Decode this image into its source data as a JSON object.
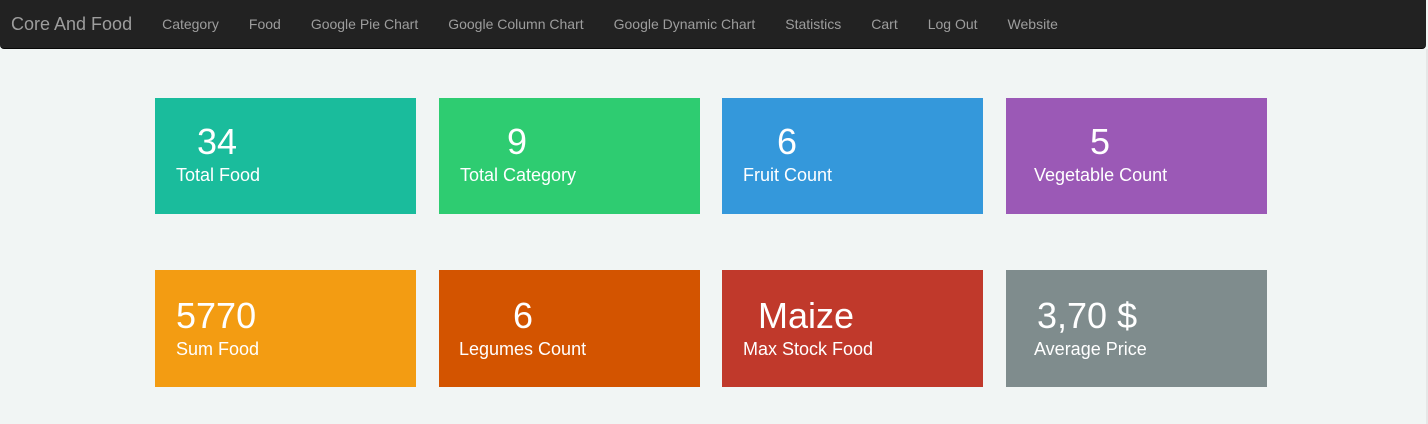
{
  "navbar": {
    "brand": "Core And Food",
    "links": [
      "Category",
      "Food",
      "Google Pie Chart",
      "Google Column Chart",
      "Google Dynamic Chart",
      "Statistics",
      "Cart",
      "Log Out",
      "Website"
    ]
  },
  "colors": {
    "navbar_bg": "#222222",
    "nav_text": "#9d9d9d",
    "page_bg": "#f1f5f4"
  },
  "tiles": [
    {
      "value": "34",
      "label": "Total Food",
      "color": "#1abc9c"
    },
    {
      "value": "9",
      "label": "Total Category",
      "color": "#2ecc71"
    },
    {
      "value": "6",
      "label": "Fruit Count",
      "color": "#3498db"
    },
    {
      "value": "5",
      "label": "Vegetable Count",
      "color": "#9b59b6"
    },
    {
      "value": "5770",
      "label": "Sum Food",
      "color": "#f39c12"
    },
    {
      "value": "6",
      "label": "Legumes Count",
      "color": "#d35400"
    },
    {
      "value": "Maize",
      "label": "Max Stock Food",
      "color": "#c0392b"
    },
    {
      "value": "3,70 $",
      "label": "Average Price",
      "color": "#7f8c8d"
    }
  ]
}
